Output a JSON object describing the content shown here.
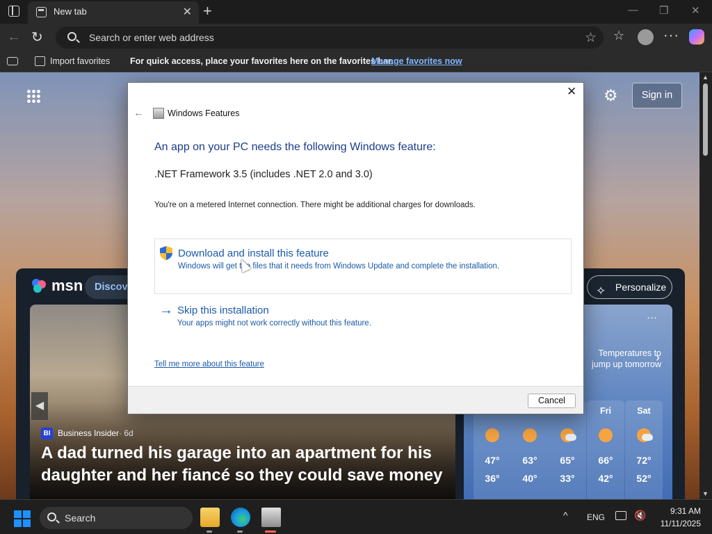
{
  "browser": {
    "tab_title": "New tab",
    "tab_close": "✕",
    "new_tab": "+",
    "window_controls": {
      "minimize": "—",
      "restore": "❐",
      "close": "✕"
    },
    "address_placeholder": "Search or enter web address",
    "favorites_bar": {
      "import_label": "Import favorites",
      "message": "For quick access, place your favorites here on the favorites bar.",
      "manage_link": "Manage favorites now"
    },
    "accent": "#7fb6ff"
  },
  "newtab": {
    "signin_label": "Sign in",
    "msn_label": "msn",
    "discover_label": "Discove",
    "personalize_label": "Personalize",
    "hero": {
      "source_badge": "BI",
      "source": "Business Insider",
      "age": "· 6d",
      "headline": "A dad turned his garage into an apartment for his daughter and her fiancé so they could save money"
    },
    "weather": {
      "more": "···",
      "message": "Temperatures to jump up tomorrow",
      "next": "›",
      "forecast": [
        {
          "day": "",
          "icon": "sun-icon",
          "high": "47°",
          "low": "36°"
        },
        {
          "day": "",
          "icon": "sun-icon",
          "high": "63°",
          "low": "40°"
        },
        {
          "day": "",
          "icon": "partly-cloudy-icon",
          "high": "65°",
          "low": "33°"
        },
        {
          "day": "Fri",
          "icon": "sun-icon",
          "high": "66°",
          "low": "42°"
        },
        {
          "day": "Sat",
          "icon": "partly-cloudy-icon",
          "high": "72°",
          "low": "52°"
        }
      ]
    }
  },
  "dialog": {
    "title": "Windows Features",
    "heading": "An app on your PC needs the following Windows feature:",
    "feature": ".NET Framework 3.5 (includes .NET 2.0 and 3.0)",
    "note": "You're on a metered Internet connection. There might be additional charges for downloads.",
    "option_download": {
      "title": "Download and install this feature",
      "description": "Windows will get the files that it needs from Windows Update and complete the installation."
    },
    "option_skip": {
      "title": "Skip this installation",
      "description": "Your apps might not work correctly without this feature."
    },
    "more_link": "Tell me more about this feature",
    "cancel_label": "Cancel",
    "close_glyph": "✕",
    "back_glyph": "←"
  },
  "taskbar": {
    "search_label": "Search",
    "tray_chevron": "^",
    "language": "ENG",
    "time": "9:31 AM",
    "date": "11/11/2025"
  }
}
